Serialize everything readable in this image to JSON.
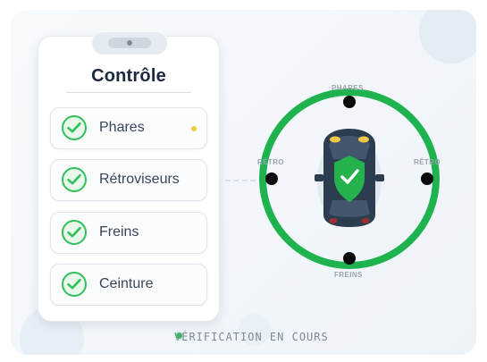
{
  "colors": {
    "accent": "#32bf5c",
    "ring": "#1fb34f",
    "warning": "#f0c64b",
    "text_dark": "#1e2940",
    "text_muted": "#7f8a95",
    "car_body": "#2d3d50",
    "shield": "#25b24d"
  },
  "checklist": {
    "title": "Contrôle",
    "items": [
      {
        "label": "Phares",
        "icon": "check-icon",
        "status": "checked",
        "has_indicator": true
      },
      {
        "label": "Rétroviseurs",
        "icon": "check-icon",
        "status": "checked",
        "has_indicator": false
      },
      {
        "label": "Freins",
        "icon": "check-icon",
        "status": "checked",
        "has_indicator": false
      },
      {
        "label": "Ceinture",
        "icon": "check-icon",
        "status": "checked",
        "has_indicator": false
      }
    ]
  },
  "vehicle_diagram": {
    "labels": {
      "top": "PHARES",
      "left": "RÉTRO",
      "right": "RÉTRO",
      "bottom": "FREINS"
    },
    "icons": {
      "car": "car-top-view-icon",
      "shield": "shield-check-icon"
    }
  },
  "status": {
    "text": "VÉRIFICATION EN COURS"
  }
}
